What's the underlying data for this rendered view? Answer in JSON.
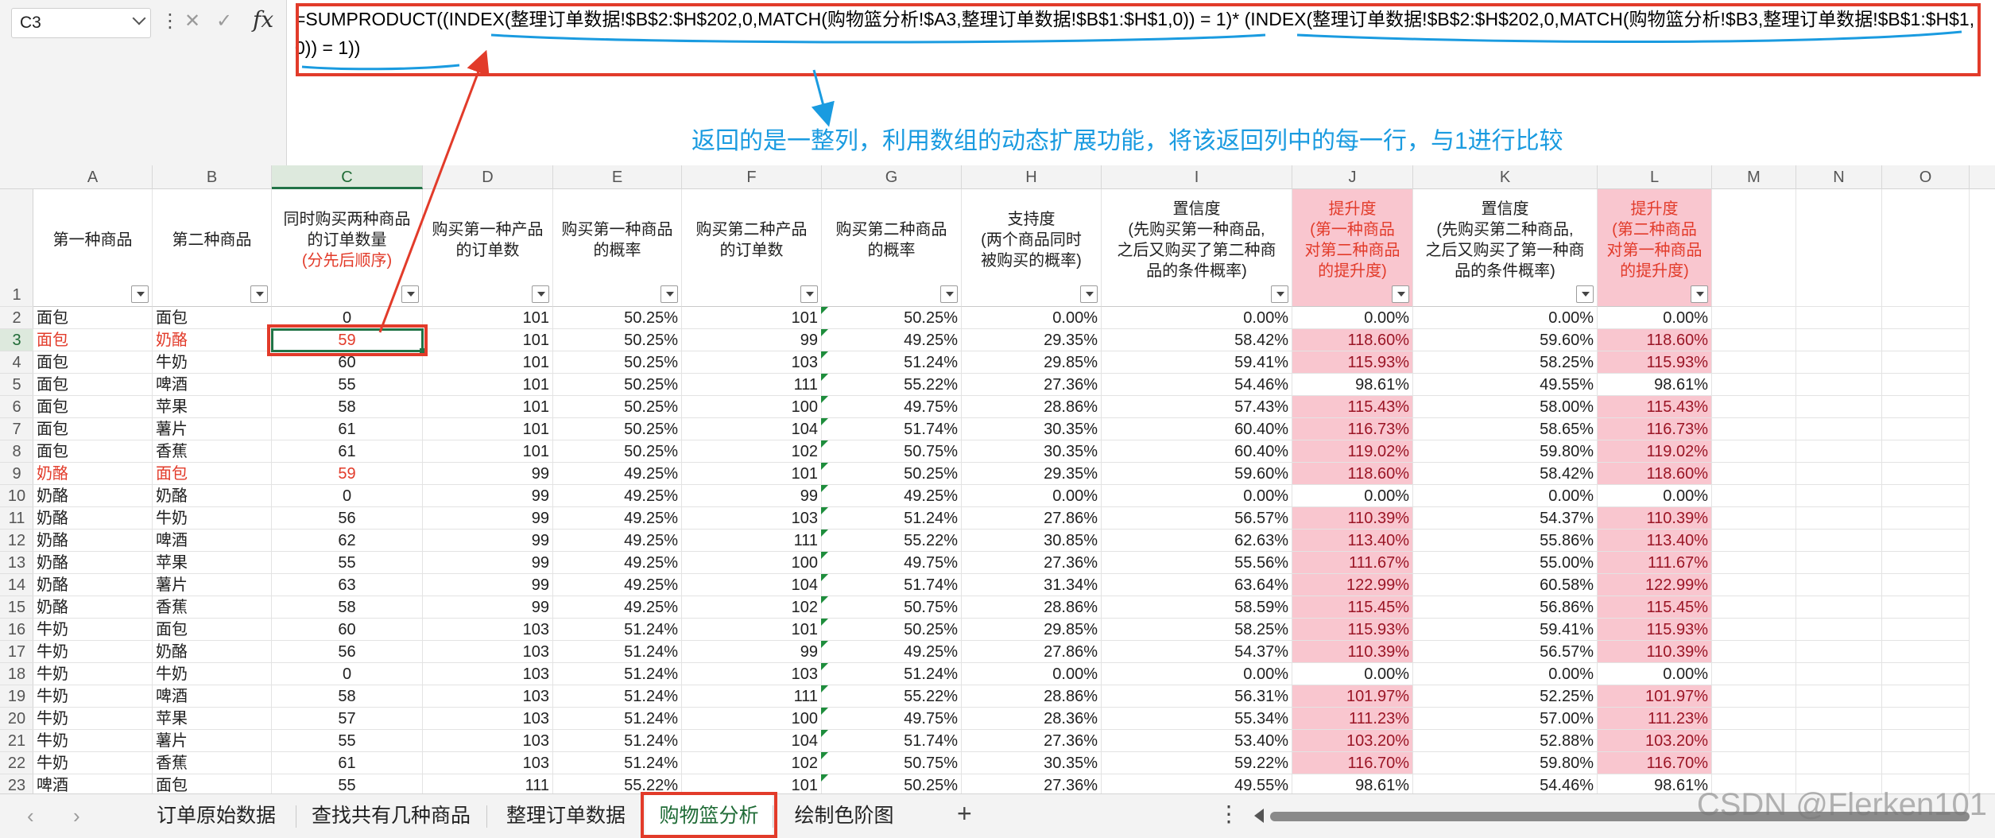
{
  "name_box": {
    "value": "C3"
  },
  "formula_bar": {
    "fx_label": "fx",
    "formula": "=SUMPRODUCT((INDEX(整理订单数据!$B$2:$H$202,0,MATCH(购物篮分析!$A3,整理订单数据!$B$1:$H$1,0)) = 1)* (INDEX(整理订单数据!$B$2:$H$202,0,MATCH(购物篮分析!$B3,整理订单数据!$B$1:$H$1,0)) = 1))"
  },
  "annotation": "返回的是一整列，利用数组的动态扩展功能，将该返回列中的每一行，与1进行比较",
  "columns": [
    "A",
    "B",
    "C",
    "D",
    "E",
    "F",
    "G",
    "H",
    "I",
    "J",
    "K",
    "L",
    "M",
    "N",
    "O"
  ],
  "selected_column": "C",
  "selected_row": "3",
  "headers": [
    {
      "text": "第一种商品"
    },
    {
      "text": "第二种商品"
    },
    {
      "text": "同时购买两种商品\n的订单数量",
      "note": "(分先后顺序)"
    },
    {
      "text": "购买第一种产品\n的订单数"
    },
    {
      "text": "购买第一种商品\n的概率"
    },
    {
      "text": "购买第二种产品\n的订单数"
    },
    {
      "text": "购买第二种商品\n的概率"
    },
    {
      "text": "支持度\n(两个商品同时\n被购买的概率)"
    },
    {
      "text": "置信度\n(先购买第一种商品,\n之后又购买了第二种商\n品的条件概率)"
    },
    {
      "text": "提升度\n(第一种商品\n对第二种商品\n的提升度)"
    },
    {
      "text": "置信度\n(先购买第二种商品,\n之后又购买了第一种商\n品的条件概率)"
    },
    {
      "text": "提升度\n(第二种商品\n对第一种商品\n的提升度)"
    }
  ],
  "rows": [
    [
      "2",
      "面包",
      "面包",
      "0",
      "101",
      "50.25%",
      "101",
      "50.25%",
      "0.00%",
      "0.00%",
      "0.00%",
      "0.00%",
      "0.00%"
    ],
    [
      "3",
      "面包",
      "奶酪",
      "59",
      "101",
      "50.25%",
      "99",
      "49.25%",
      "29.35%",
      "58.42%",
      "118.60%",
      "59.60%",
      "118.60%"
    ],
    [
      "4",
      "面包",
      "牛奶",
      "60",
      "101",
      "50.25%",
      "103",
      "51.24%",
      "29.85%",
      "59.41%",
      "115.93%",
      "58.25%",
      "115.93%"
    ],
    [
      "5",
      "面包",
      "啤酒",
      "55",
      "101",
      "50.25%",
      "111",
      "55.22%",
      "27.36%",
      "54.46%",
      "98.61%",
      "49.55%",
      "98.61%"
    ],
    [
      "6",
      "面包",
      "苹果",
      "58",
      "101",
      "50.25%",
      "100",
      "49.75%",
      "28.86%",
      "57.43%",
      "115.43%",
      "58.00%",
      "115.43%"
    ],
    [
      "7",
      "面包",
      "薯片",
      "61",
      "101",
      "50.25%",
      "104",
      "51.74%",
      "30.35%",
      "60.40%",
      "116.73%",
      "58.65%",
      "116.73%"
    ],
    [
      "8",
      "面包",
      "香蕉",
      "61",
      "101",
      "50.25%",
      "102",
      "50.75%",
      "30.35%",
      "60.40%",
      "119.02%",
      "59.80%",
      "119.02%"
    ],
    [
      "9",
      "奶酪",
      "面包",
      "59",
      "99",
      "49.25%",
      "101",
      "50.25%",
      "29.35%",
      "59.60%",
      "118.60%",
      "58.42%",
      "118.60%"
    ],
    [
      "10",
      "奶酪",
      "奶酪",
      "0",
      "99",
      "49.25%",
      "99",
      "49.25%",
      "0.00%",
      "0.00%",
      "0.00%",
      "0.00%",
      "0.00%"
    ],
    [
      "11",
      "奶酪",
      "牛奶",
      "56",
      "99",
      "49.25%",
      "103",
      "51.24%",
      "27.86%",
      "56.57%",
      "110.39%",
      "54.37%",
      "110.39%"
    ],
    [
      "12",
      "奶酪",
      "啤酒",
      "62",
      "99",
      "49.25%",
      "111",
      "55.22%",
      "30.85%",
      "62.63%",
      "113.40%",
      "55.86%",
      "113.40%"
    ],
    [
      "13",
      "奶酪",
      "苹果",
      "55",
      "99",
      "49.25%",
      "100",
      "49.75%",
      "27.36%",
      "55.56%",
      "111.67%",
      "55.00%",
      "111.67%"
    ],
    [
      "14",
      "奶酪",
      "薯片",
      "63",
      "99",
      "49.25%",
      "104",
      "51.74%",
      "31.34%",
      "63.64%",
      "122.99%",
      "60.58%",
      "122.99%"
    ],
    [
      "15",
      "奶酪",
      "香蕉",
      "58",
      "99",
      "49.25%",
      "102",
      "50.75%",
      "28.86%",
      "58.59%",
      "115.45%",
      "56.86%",
      "115.45%"
    ],
    [
      "16",
      "牛奶",
      "面包",
      "60",
      "103",
      "51.24%",
      "101",
      "50.25%",
      "29.85%",
      "58.25%",
      "115.93%",
      "59.41%",
      "115.93%"
    ],
    [
      "17",
      "牛奶",
      "奶酪",
      "56",
      "103",
      "51.24%",
      "99",
      "49.25%",
      "27.86%",
      "54.37%",
      "110.39%",
      "56.57%",
      "110.39%"
    ],
    [
      "18",
      "牛奶",
      "牛奶",
      "0",
      "103",
      "51.24%",
      "103",
      "51.24%",
      "0.00%",
      "0.00%",
      "0.00%",
      "0.00%",
      "0.00%"
    ],
    [
      "19",
      "牛奶",
      "啤酒",
      "58",
      "103",
      "51.24%",
      "111",
      "55.22%",
      "28.86%",
      "56.31%",
      "101.97%",
      "52.25%",
      "101.97%"
    ],
    [
      "20",
      "牛奶",
      "苹果",
      "57",
      "103",
      "51.24%",
      "100",
      "49.75%",
      "28.36%",
      "55.34%",
      "111.23%",
      "57.00%",
      "111.23%"
    ],
    [
      "21",
      "牛奶",
      "薯片",
      "55",
      "103",
      "51.24%",
      "104",
      "51.74%",
      "27.36%",
      "53.40%",
      "103.20%",
      "52.88%",
      "103.20%"
    ],
    [
      "22",
      "牛奶",
      "香蕉",
      "61",
      "103",
      "51.24%",
      "102",
      "50.75%",
      "30.35%",
      "59.22%",
      "116.70%",
      "59.80%",
      "116.70%"
    ],
    [
      "23",
      "啤酒",
      "面包",
      "55",
      "111",
      "55.22%",
      "101",
      "50.25%",
      "27.36%",
      "49.55%",
      "98.61%",
      "54.46%",
      "98.61%"
    ]
  ],
  "red_rows": [
    "3",
    "9"
  ],
  "sheet_tabs": [
    "订单原始数据",
    "查找共有几种商品",
    "整理订单数据",
    "购物篮分析",
    "绘制色阶图"
  ],
  "active_tab": "购物篮分析",
  "watermark": "CSDN @Flerken101",
  "colors": {
    "excel_green": "#217346",
    "highlight_red": "#e23b2a",
    "annotation_blue": "#1a9be0",
    "pink_fill": "#f9c6cf"
  }
}
